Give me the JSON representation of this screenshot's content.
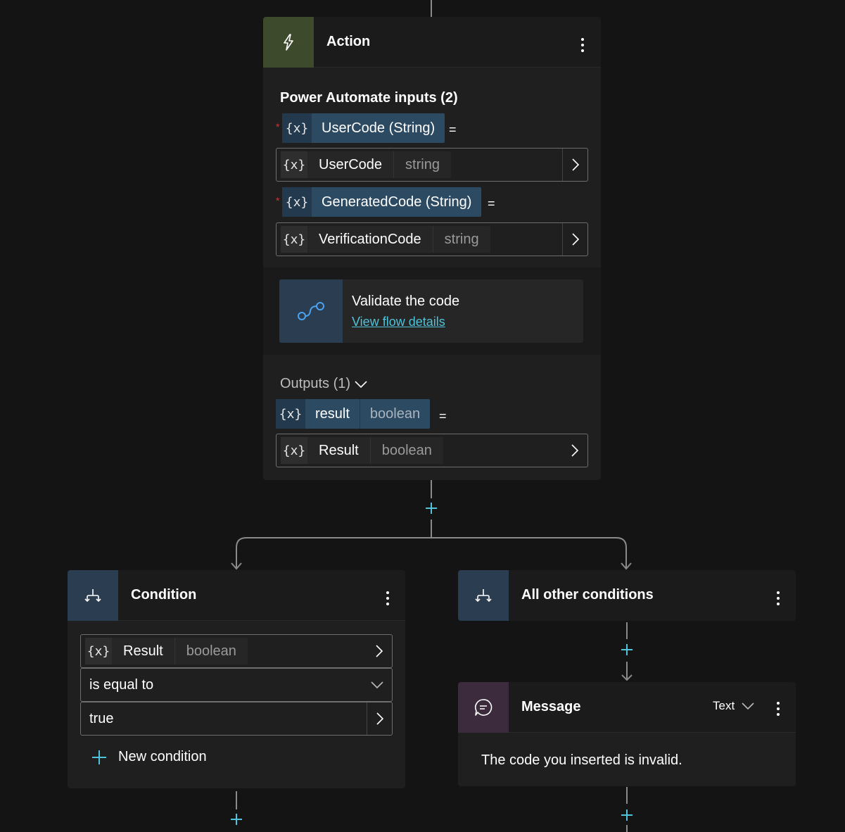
{
  "action_card": {
    "title": "Action",
    "inputs_header": "Power Automate inputs (2)",
    "inputs": [
      {
        "param_label": "UserCode (String)",
        "value_name": "UserCode",
        "value_type": "string"
      },
      {
        "param_label": "GeneratedCode (String)",
        "value_name": "VerificationCode",
        "value_type": "string"
      }
    ],
    "flow": {
      "name": "Validate the code",
      "link": "View flow details"
    },
    "outputs_header": "Outputs (1)",
    "output": {
      "var_name": "result",
      "var_type": "boolean",
      "value_name": "Result",
      "value_type": "boolean"
    },
    "var_glyph": "{x}",
    "equals": "=",
    "required_mark": "*"
  },
  "condition_card": {
    "title": "Condition",
    "left_name": "Result",
    "left_type": "boolean",
    "operator": "is equal to",
    "right_value": "true",
    "new_condition": "New condition"
  },
  "other_card": {
    "title": "All other conditions"
  },
  "message_card": {
    "title": "Message",
    "format": "Text",
    "body": "The code you inserted is invalid."
  },
  "colors": {
    "canvas": "#141414",
    "card": "#1f1f1f",
    "action_icon_bg": "#3e4a2c",
    "branch_icon_bg": "#2b3d50",
    "message_icon_bg": "#3b2b3d",
    "variable_chip": "#2d4a63",
    "accent_plus": "#4fc3d9",
    "link": "#4fc3d9",
    "required": "#d13438"
  },
  "icons": {
    "action": "lightning-icon",
    "flow": "flow-icon",
    "branch": "branch-icon",
    "message": "chat-bubble-icon",
    "more": "more-vertical-icon",
    "add": "plus-icon",
    "expand": "chevron-right-icon",
    "dropdown": "chevron-down-icon"
  }
}
